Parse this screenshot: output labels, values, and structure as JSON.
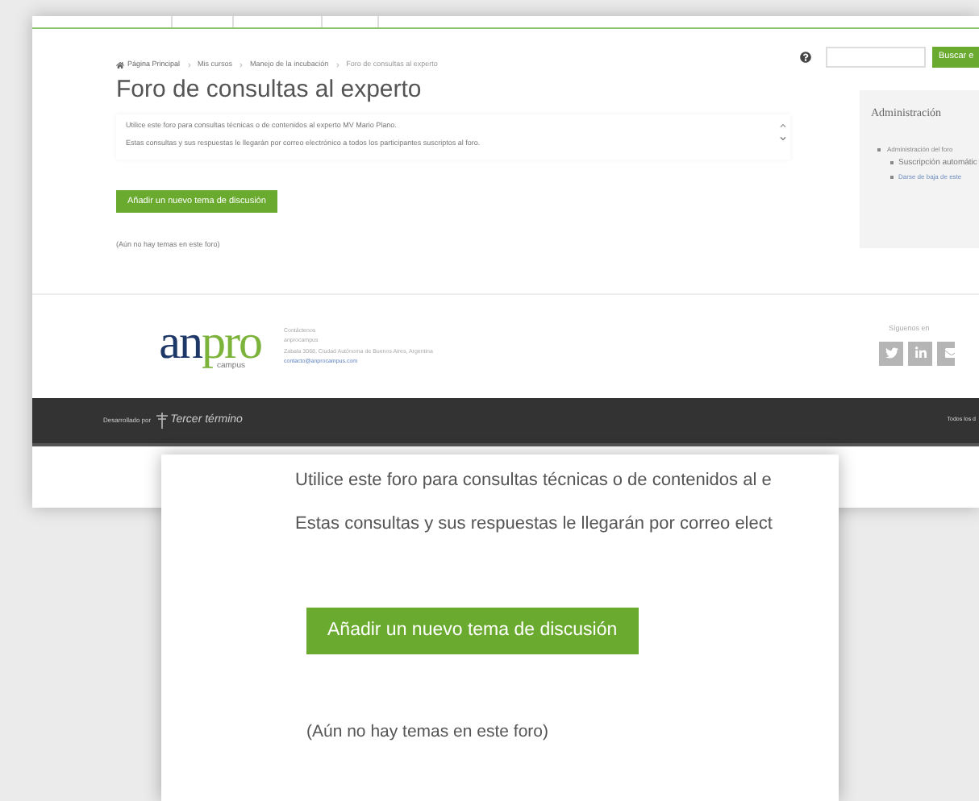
{
  "header": {
    "search_button": "Buscar e"
  },
  "breadcrumb": [
    {
      "label": "Página Principal",
      "kind": "home"
    },
    {
      "label": "Mis cursos",
      "kind": "link"
    },
    {
      "label": "Manejo de la incubación",
      "kind": "link"
    },
    {
      "label": "Foro de consultas al experto",
      "kind": "current"
    }
  ],
  "title": "Foro de consultas al experto",
  "intro": [
    "Utilice este foro para consultas técnicas o de contenidos al experto MV Mario Plano.",
    "Estas consultas y sus respuestas le llegarán por correo electrónico a todos los participantes suscriptos al foro."
  ],
  "add_button": "Añadir un nuevo tema de discusión",
  "empty_message": "(Aún no hay temas en este foro)",
  "sidebar": {
    "title": "Administración",
    "items": [
      {
        "label": "Administración del foro",
        "children": [
          {
            "label": "Suscripción automátic",
            "kind": "text"
          },
          {
            "label": "Darse de baja de este",
            "kind": "link"
          }
        ]
      }
    ]
  },
  "footer": {
    "logo": {
      "main_left": "an",
      "main_right": "pro",
      "sub": "campus"
    },
    "contact": [
      {
        "text": "Contáctenos",
        "kind": "text"
      },
      {
        "text": "anprocampus",
        "kind": "text"
      },
      {
        "text": "Zabala 3068, Ciudad Autónoma de Buenos Aires, Argentina",
        "kind": "text"
      },
      {
        "text": "contacto@anprocampus.com",
        "kind": "link"
      }
    ],
    "follow_label": "Síguenos en"
  },
  "bottom_bar": {
    "developed_by": "Desarrollado por",
    "brand": "Tercer término",
    "rights": "Todos los d"
  },
  "zoom_inset": {
    "intro": [
      "Utilice este foro para consultas técnicas o de contenidos al e",
      "Estas consultas y sus respuestas le llegarán por correo elect"
    ],
    "add_button": "Añadir un nuevo tema de discusión",
    "empty_message": "(Aún no hay temas en este foro)"
  }
}
